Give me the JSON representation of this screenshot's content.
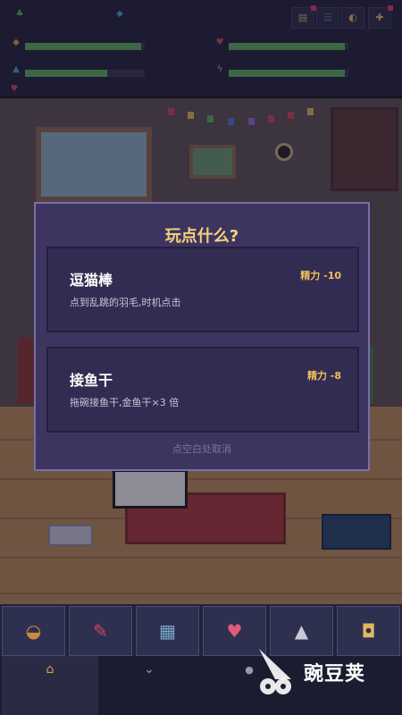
{
  "top_buttons": [
    {
      "name": "ticket-icon",
      "glyph": "▤",
      "badge": true
    },
    {
      "name": "list-icon",
      "glyph": "☰",
      "badge": false
    },
    {
      "name": "sound-icon",
      "glyph": "◐",
      "badge": false
    },
    {
      "name": "gift-icon",
      "glyph": "🎁",
      "badge": true
    }
  ],
  "stats": [
    {
      "name": "hunger",
      "icon": "◆",
      "color": "#d9a040",
      "value": 0.97
    },
    {
      "name": "affection",
      "icon": "♥",
      "color": "#d0455a",
      "value": 0.97
    },
    {
      "name": "hygiene",
      "icon": "▲",
      "color": "#4aa0c8",
      "value": 0.69
    },
    {
      "name": "energy",
      "icon": "⚡",
      "color": "#e0b860",
      "value": 0.97
    }
  ],
  "modal": {
    "title": "玩点什么?",
    "options": [
      {
        "name": "逗猫棒",
        "cost": "精力 -10",
        "desc": "点到乱跳的羽毛,时机点击"
      },
      {
        "name": "接鱼干",
        "cost": "精力 -8",
        "desc": "拖碗接鱼干,金鱼干×3 倍"
      }
    ],
    "cancel_hint": "点空白处取消"
  },
  "toolbar": [
    {
      "name": "food-bowl-icon",
      "glyph": "🥣"
    },
    {
      "name": "feather-toy-icon",
      "glyph": "🪶"
    },
    {
      "name": "comb-icon",
      "glyph": "▦"
    },
    {
      "name": "heart-icon",
      "glyph": "♥"
    },
    {
      "name": "iron-icon",
      "glyph": "▲"
    },
    {
      "name": "bag-icon",
      "glyph": "◘"
    }
  ],
  "watermark": {
    "text": "豌豆荚"
  }
}
